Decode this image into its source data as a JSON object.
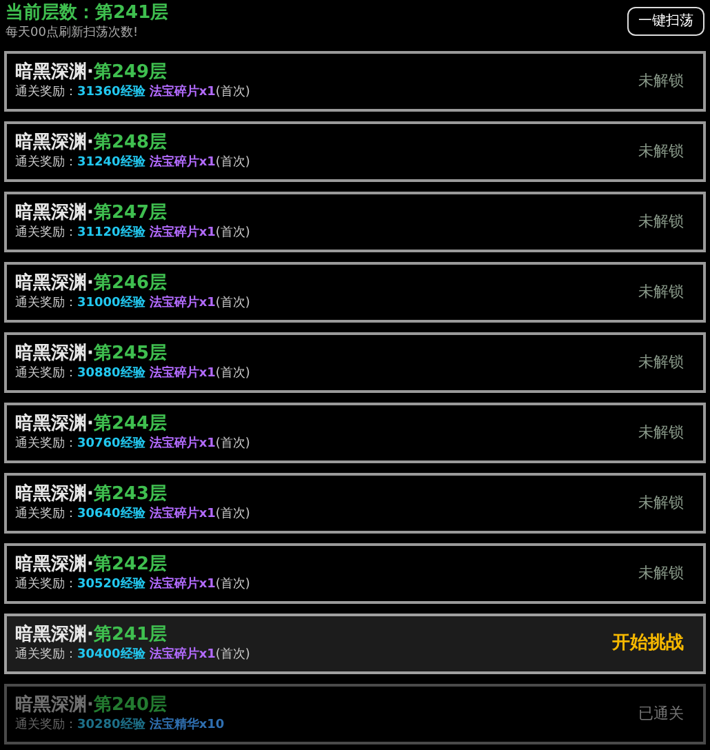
{
  "header": {
    "label": "当前层数：",
    "value": "第241层",
    "hint": "每天00点刷新扫荡次数!",
    "sweep_button": "一键扫荡"
  },
  "floors": [
    {
      "kind": "locked",
      "name": "暗黑深渊·",
      "floor": "第249层",
      "reward_label": "通关奖励：",
      "exp": "31360经验",
      "item": {
        "text": "法宝碎片x1",
        "color": "#b36bff"
      },
      "note": "(首次)",
      "status": "未解锁"
    },
    {
      "kind": "locked",
      "name": "暗黑深渊·",
      "floor": "第248层",
      "reward_label": "通关奖励：",
      "exp": "31240经验",
      "item": {
        "text": "法宝碎片x1",
        "color": "#b36bff"
      },
      "note": "(首次)",
      "status": "未解锁"
    },
    {
      "kind": "locked",
      "name": "暗黑深渊·",
      "floor": "第247层",
      "reward_label": "通关奖励：",
      "exp": "31120经验",
      "item": {
        "text": "法宝碎片x1",
        "color": "#b36bff"
      },
      "note": "(首次)",
      "status": "未解锁"
    },
    {
      "kind": "locked",
      "name": "暗黑深渊·",
      "floor": "第246层",
      "reward_label": "通关奖励：",
      "exp": "31000经验",
      "item": {
        "text": "法宝碎片x1",
        "color": "#b36bff"
      },
      "note": "(首次)",
      "status": "未解锁"
    },
    {
      "kind": "locked",
      "name": "暗黑深渊·",
      "floor": "第245层",
      "reward_label": "通关奖励：",
      "exp": "30880经验",
      "item": {
        "text": "法宝碎片x1",
        "color": "#b36bff"
      },
      "note": "(首次)",
      "status": "未解锁"
    },
    {
      "kind": "locked",
      "name": "暗黑深渊·",
      "floor": "第244层",
      "reward_label": "通关奖励：",
      "exp": "30760经验",
      "item": {
        "text": "法宝碎片x1",
        "color": "#b36bff"
      },
      "note": "(首次)",
      "status": "未解锁"
    },
    {
      "kind": "locked",
      "name": "暗黑深渊·",
      "floor": "第243层",
      "reward_label": "通关奖励：",
      "exp": "30640经验",
      "item": {
        "text": "法宝碎片x1",
        "color": "#b36bff"
      },
      "note": "(首次)",
      "status": "未解锁"
    },
    {
      "kind": "locked",
      "name": "暗黑深渊·",
      "floor": "第242层",
      "reward_label": "通关奖励：",
      "exp": "30520经验",
      "item": {
        "text": "法宝碎片x1",
        "color": "#b36bff"
      },
      "note": "(首次)",
      "status": "未解锁"
    },
    {
      "kind": "current",
      "name": "暗黑深渊·",
      "floor": "第241层",
      "reward_label": "通关奖励：",
      "exp": "30400经验",
      "item": {
        "text": "法宝碎片x1",
        "color": "#b36bff"
      },
      "note": "(首次)",
      "status": "开始挑战"
    },
    {
      "kind": "cleared",
      "name": "暗黑深渊·",
      "floor": "第240层",
      "reward_label": "通关奖励：",
      "exp": "30280经验",
      "item": {
        "text": "法宝精华x10",
        "color": "#2f6fb0"
      },
      "status": "已通关"
    }
  ]
}
